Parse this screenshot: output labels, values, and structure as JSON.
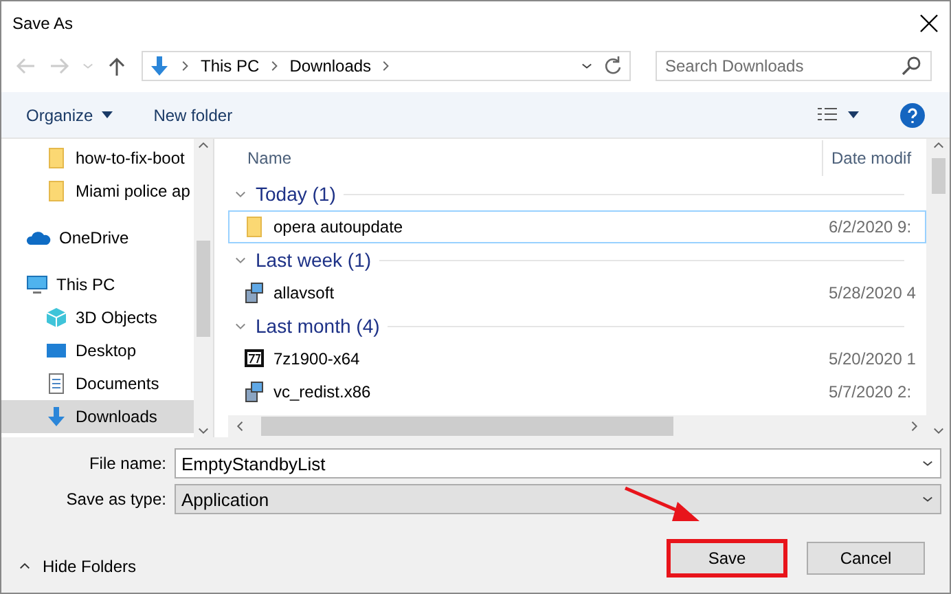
{
  "window": {
    "title": "Save As"
  },
  "address": {
    "crumbs": [
      "This PC",
      "Downloads"
    ]
  },
  "search": {
    "placeholder": "Search Downloads"
  },
  "toolbar": {
    "organize": "Organize",
    "new_folder": "New folder"
  },
  "nav_items": [
    {
      "label": "how-to-fix-boot",
      "kind": "folder",
      "selected": false
    },
    {
      "label": "Miami police ap",
      "kind": "folder",
      "selected": false
    },
    {
      "label": "OneDrive",
      "kind": "cloud",
      "selected": false
    },
    {
      "label": "This PC",
      "kind": "pc",
      "selected": false,
      "children": [
        {
          "label": "3D Objects",
          "kind": "cube",
          "selected": false
        },
        {
          "label": "Desktop",
          "kind": "desktop",
          "selected": false
        },
        {
          "label": "Documents",
          "kind": "document",
          "selected": false
        },
        {
          "label": "Downloads",
          "kind": "download",
          "selected": true
        }
      ]
    }
  ],
  "columns": {
    "name": "Name",
    "date": "Date modif"
  },
  "groups": [
    {
      "title": "Today (1)",
      "files": [
        {
          "name": "opera autoupdate",
          "date": "6/2/2020 9:",
          "kind": "folder",
          "focused": true
        }
      ]
    },
    {
      "title": "Last week (1)",
      "files": [
        {
          "name": "allavsoft",
          "date": "5/28/2020 4",
          "kind": "installer",
          "focused": false
        }
      ]
    },
    {
      "title": "Last month (4)",
      "files": [
        {
          "name": "7z1900-x64",
          "date": "5/20/2020 1",
          "kind": "archive",
          "focused": false
        },
        {
          "name": "vc_redist.x86",
          "date": "5/7/2020 2:",
          "kind": "installer",
          "focused": false
        }
      ]
    }
  ],
  "file_name": {
    "label": "File name:",
    "value": "EmptyStandbyList"
  },
  "save_type": {
    "label": "Save as type:",
    "value": "Application"
  },
  "hide_folders": "Hide Folders",
  "buttons": [
    {
      "label": "Save",
      "highlighted": true
    },
    {
      "label": "Cancel",
      "highlighted": false
    }
  ]
}
